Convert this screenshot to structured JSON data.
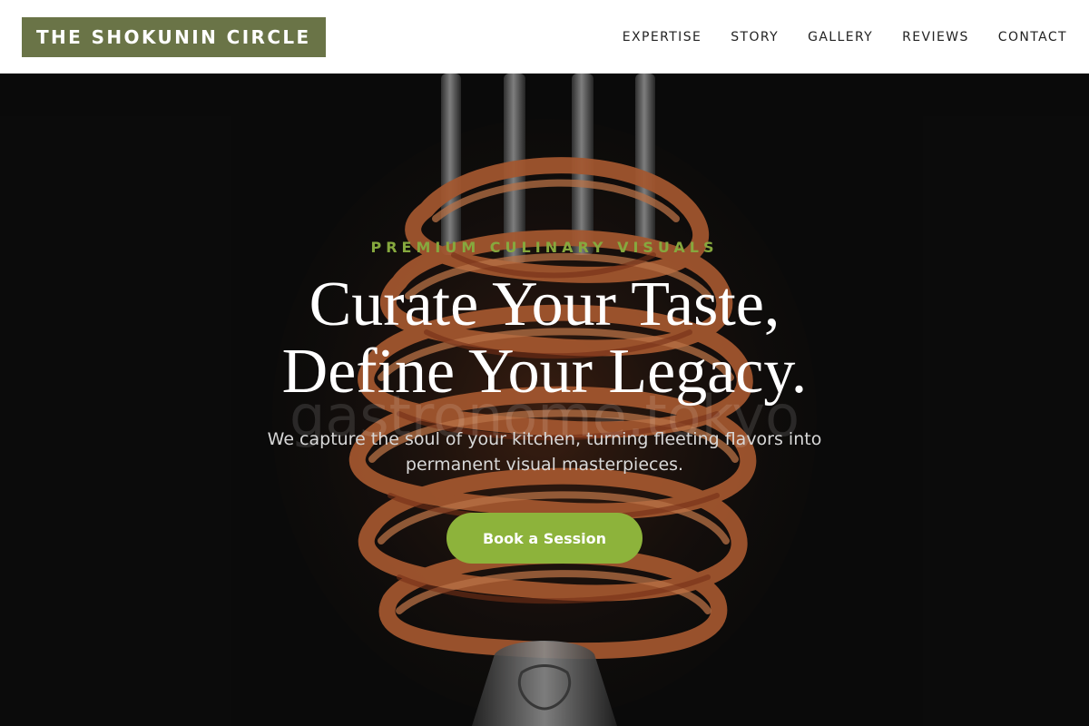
{
  "brand": {
    "name": "THE SHOKUNIN CIRCLE"
  },
  "nav": {
    "items": [
      "EXPERTISE",
      "STORY",
      "GALLERY",
      "REVIEWS",
      "CONTACT"
    ]
  },
  "hero": {
    "eyebrow": "PREMIUM CULINARY VISUALS",
    "headline_line1": "Curate Your Taste,",
    "headline_line2": "Define Your Legacy.",
    "watermark": "gastronome.tokyo",
    "subtitle_line1": "We capture the soul of your kitchen, turning fleeting flavors into",
    "subtitle_line2": "permanent visual masterpieces.",
    "cta_label": "Book a Session",
    "image_subject": "fork-twirled-spaghetti-photo"
  },
  "colors": {
    "brand_bg": "#6a7447",
    "accent_green": "#8db33b",
    "eyebrow_green": "#86a83e",
    "hero_bg": "#0d0d0d"
  }
}
